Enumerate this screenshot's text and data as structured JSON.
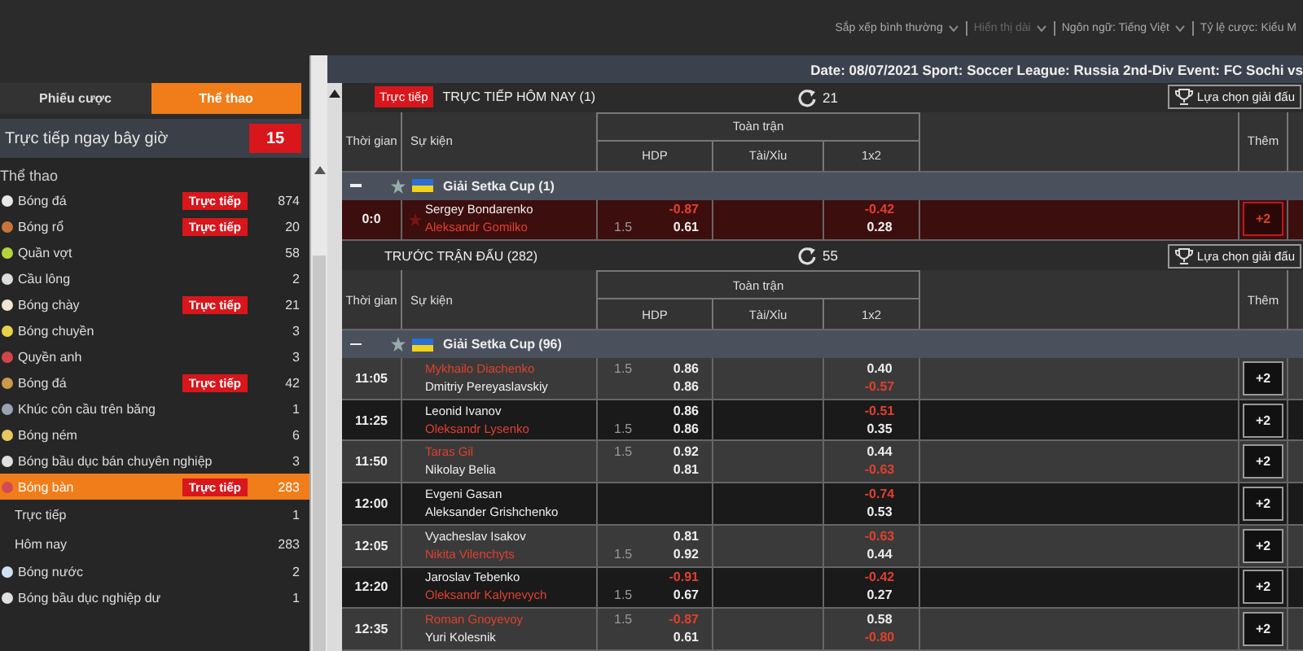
{
  "top_menu": [
    {
      "label": "Sắp xếp bình thường",
      "disabled": false,
      "dropdown": true
    },
    {
      "label": "Hiển thị dài",
      "disabled": true,
      "dropdown": true
    },
    {
      "label": "Ngôn ngữ: Tiếng Việt",
      "disabled": false,
      "dropdown": true
    },
    {
      "label": "Tỷ lệ cược: Kiểu M",
      "disabled": false,
      "dropdown": false
    }
  ],
  "info_bar": {
    "text": "Date: 08/07/2021 Sport: Soccer League: Russia 2nd-Div Event: FC Sochi vs"
  },
  "sidebar": {
    "tabs": [
      {
        "label": "Phiếu cược",
        "selected": false
      },
      {
        "label": "Thể thao",
        "selected": true
      }
    ],
    "live_now": {
      "label": "Trực tiếp ngay bây giờ",
      "count": "15"
    },
    "heading": "Thể thao",
    "items": [
      {
        "name": "Bóng đá",
        "badge": "Trực tiếp",
        "count": "874",
        "selected": false,
        "color": "#e8e8e8"
      },
      {
        "name": "Bóng rổ",
        "badge": "Trực tiếp",
        "count": "20",
        "selected": false,
        "color": "#c8743a"
      },
      {
        "name": "Quần vợt",
        "count": "58",
        "selected": false,
        "color": "#b6d33a"
      },
      {
        "name": "Cầu lông",
        "count": "2",
        "selected": false,
        "color": "#dddddd"
      },
      {
        "name": "Bóng chày",
        "badge": "Trực tiếp",
        "count": "21",
        "selected": false,
        "color": "#f0e6d0"
      },
      {
        "name": "Bóng chuyền",
        "count": "3",
        "selected": false,
        "color": "#e8d24a"
      },
      {
        "name": "Quyền anh",
        "count": "3",
        "selected": false,
        "color": "#d2464b"
      },
      {
        "name": "Bóng đá",
        "badge": "Trực tiếp",
        "count": "42",
        "selected": false,
        "color": "#c89a4a"
      },
      {
        "name": "Khúc côn cầu trên băng",
        "count": "1",
        "selected": false,
        "color": "#9aa3b0"
      },
      {
        "name": "Bóng ném",
        "count": "6",
        "selected": false,
        "color": "#e8c860"
      },
      {
        "name": "Bóng bầu dục bán chuyên nghiệp",
        "count": "3",
        "selected": false,
        "color": "#e0e0e0"
      },
      {
        "name": "Bóng bàn",
        "badge": "Trực tiếp",
        "count": "283",
        "selected": true,
        "color": "#d24a5a",
        "children": [
          {
            "name": "Trực tiếp",
            "count": "1",
            "selected": false
          },
          {
            "name": "Hôm nay",
            "count": "283",
            "selected": false
          }
        ]
      },
      {
        "name": "Bóng nước",
        "count": "2",
        "selected": false,
        "color": "#cfe2f5"
      },
      {
        "name": "Bóng bầu dục nghiệp dư",
        "count": "1",
        "selected": false,
        "color": "#e0e0e0"
      }
    ]
  },
  "sections": [
    {
      "badge": "Trực tiếp",
      "title": "TRỰC TIẾP HÔM NAY (1)",
      "refresh_count": "21",
      "filter_button": "Lựa chọn giải đấu",
      "columns": {
        "time": "Thời gian",
        "event": "Sự kiện",
        "group": "Toàn trận",
        "hdp": "HDP",
        "over_under": "Tài/Xỉu",
        "x12": "1x2",
        "more": "Thêm"
      },
      "leagues": [
        {
          "name": "Giải Setka Cup (1)",
          "matches": [
            {
              "kind": "live",
              "time": "0:0",
              "teams": [
                {
                  "name": "Sergey Bondarenko",
                  "highlight": false
                },
                {
                  "name": "Aleksandr Gomilko",
                  "highlight": true
                }
              ],
              "hdp": [
                {
                  "value": "-0.87",
                  "negative": true
                },
                {
                  "line": "1.5",
                  "value": "0.61",
                  "negative": false
                }
              ],
              "x12": [
                {
                  "value": "-0.42",
                  "negative": true
                },
                {
                  "value": "0.28",
                  "negative": false
                }
              ],
              "more": "+2"
            }
          ]
        }
      ]
    },
    {
      "title": "TRƯỚC TRẬN ĐẤU (282)",
      "refresh_count": "55",
      "filter_button": "Lựa chọn giải đấu",
      "columns": {
        "time": "Thời gian",
        "event": "Sự kiện",
        "group": "Toàn trận",
        "hdp": "HDP",
        "over_under": "Tài/Xỉu",
        "x12": "1x2",
        "more": "Thêm"
      },
      "leagues": [
        {
          "name": "Giải Setka Cup (96)",
          "matches": [
            {
              "kind": "upcoming",
              "time": "11:05",
              "teams": [
                {
                  "name": "Mykhailo Diachenko",
                  "highlight": true
                },
                {
                  "name": "Dmitriy Pereyaslavskiy",
                  "highlight": false
                }
              ],
              "hdp": [
                {
                  "line": "1.5",
                  "value": "0.86",
                  "negative": false
                },
                {
                  "value": "0.86",
                  "negative": false
                }
              ],
              "x12": [
                {
                  "value": "0.40",
                  "negative": false
                },
                {
                  "value": "-0.57",
                  "negative": true
                }
              ],
              "more": "+2"
            },
            {
              "kind": "upcoming",
              "time": "11:25",
              "teams": [
                {
                  "name": "Leonid Ivanov",
                  "highlight": false
                },
                {
                  "name": "Oleksandr Lysenko",
                  "highlight": true
                }
              ],
              "hdp": [
                {
                  "value": "0.86",
                  "negative": false
                },
                {
                  "line": "1.5",
                  "value": "0.86",
                  "negative": false
                }
              ],
              "x12": [
                {
                  "value": "-0.51",
                  "negative": true
                },
                {
                  "value": "0.35",
                  "negative": false
                }
              ],
              "more": "+2"
            },
            {
              "kind": "upcoming",
              "time": "11:50",
              "teams": [
                {
                  "name": "Taras Gil",
                  "highlight": true
                },
                {
                  "name": "Nikolay Belia",
                  "highlight": false
                }
              ],
              "hdp": [
                {
                  "line": "1.5",
                  "value": "0.92",
                  "negative": false
                },
                {
                  "value": "0.81",
                  "negative": false
                }
              ],
              "x12": [
                {
                  "value": "0.44",
                  "negative": false
                },
                {
                  "value": "-0.63",
                  "negative": true
                }
              ],
              "more": "+2"
            },
            {
              "kind": "upcoming",
              "time": "12:00",
              "teams": [
                {
                  "name": "Evgeni Gasan",
                  "highlight": false
                },
                {
                  "name": "Aleksander Grishchenko",
                  "highlight": false
                }
              ],
              "x12": [
                {
                  "value": "-0.74",
                  "negative": true
                },
                {
                  "value": "0.53",
                  "negative": false
                }
              ],
              "more": "+2"
            },
            {
              "kind": "upcoming",
              "time": "12:05",
              "teams": [
                {
                  "name": "Vyacheslav Isakov",
                  "highlight": false
                },
                {
                  "name": "Nikita Vilenchyts",
                  "highlight": true
                }
              ],
              "hdp": [
                {
                  "value": "0.81",
                  "negative": false
                },
                {
                  "line": "1.5",
                  "value": "0.92",
                  "negative": false
                }
              ],
              "x12": [
                {
                  "value": "-0.63",
                  "negative": true
                },
                {
                  "value": "0.44",
                  "negative": false
                }
              ],
              "more": "+2"
            },
            {
              "kind": "upcoming",
              "time": "12:20",
              "teams": [
                {
                  "name": "Jaroslav Tebenko",
                  "highlight": false
                },
                {
                  "name": "Oleksandr Kalynevych",
                  "highlight": true
                }
              ],
              "hdp": [
                {
                  "value": "-0.91",
                  "negative": true
                },
                {
                  "line": "1.5",
                  "value": "0.67",
                  "negative": false
                }
              ],
              "x12": [
                {
                  "value": "-0.42",
                  "negative": true
                },
                {
                  "value": "0.27",
                  "negative": false
                }
              ],
              "more": "+2"
            },
            {
              "kind": "upcoming",
              "time": "12:35",
              "teams": [
                {
                  "name": "Roman Gnoyevoy",
                  "highlight": true
                },
                {
                  "name": "Yuri Kolesnik",
                  "highlight": false
                }
              ],
              "hdp": [
                {
                  "line": "1.5",
                  "value": "-0.87",
                  "negative": true
                },
                {
                  "value": "0.61",
                  "negative": false
                }
              ],
              "x12": [
                {
                  "value": "0.58",
                  "negative": false
                },
                {
                  "value": "-0.80",
                  "negative": true
                }
              ],
              "more": "+2"
            }
          ]
        }
      ]
    }
  ]
}
